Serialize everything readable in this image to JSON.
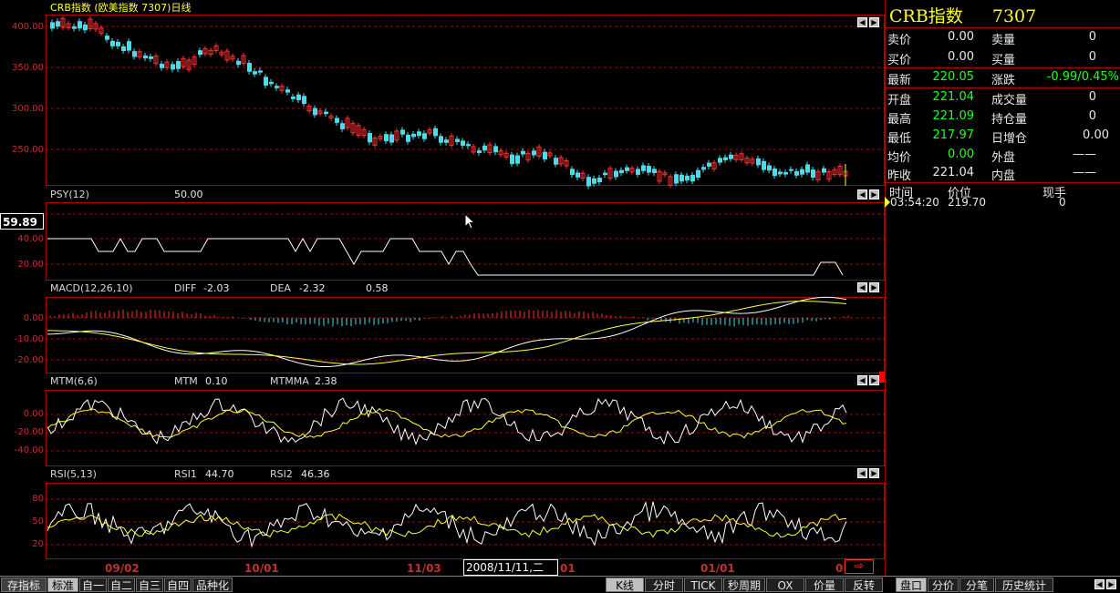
{
  "header": {
    "title": "CRB指数 (欧美指数 7307)日线"
  },
  "panes": {
    "price": {
      "yticks": [
        "400.00",
        "350.00",
        "300.00",
        "250.00"
      ]
    },
    "psy": {
      "name": "PSY(12)",
      "value": "50.00",
      "yticks": [
        "40.00",
        "20.00"
      ],
      "cursor_value": "59.89"
    },
    "macd": {
      "name": "MACD(12,26,10)",
      "diff_label": "DIFF",
      "diff": "-2.03",
      "dea_label": "DEA",
      "dea": "-2.32",
      "macd": "0.58",
      "yticks": [
        "0.00",
        "-10.00",
        "-20.00"
      ]
    },
    "mtm": {
      "name": "MTM(6,6)",
      "mtm_label": "MTM",
      "mtm": "0.10",
      "mtmma_label": "MTMMA",
      "mtmma": "2.38",
      "yticks": [
        "0.00",
        "-20.00",
        "-40.00"
      ]
    },
    "rsi": {
      "name": "RSI(5,13)",
      "rsi1_label": "RSI1",
      "rsi1": "44.70",
      "rsi2_label": "RSI2",
      "rsi2": "46.36",
      "yticks": [
        "80",
        "50",
        "20"
      ]
    }
  },
  "xaxis": {
    "labels": [
      "09/02",
      "10/01",
      "11/03",
      "01",
      "01/01",
      "0"
    ],
    "cursor_date": "2008/11/11,二"
  },
  "quote": {
    "name": "CRB指数",
    "code": "7307",
    "rows": [
      {
        "l1": "卖价",
        "v1": "0.00",
        "l2": "卖量",
        "v2": "0"
      },
      {
        "l1": "买价",
        "v1": "0.00",
        "l2": "买量",
        "v2": "0"
      },
      {
        "l1": "最新",
        "v1": "220.05",
        "l2": "涨跌",
        "v2": "-0.99/0.45%"
      },
      {
        "l1": "开盘",
        "v1": "221.04",
        "l2": "成交量",
        "v2": "0"
      },
      {
        "l1": "最高",
        "v1": "221.09",
        "l2": "持仓量",
        "v2": "0"
      },
      {
        "l1": "最低",
        "v1": "217.97",
        "l2": "日增仓",
        "v2": "0.00"
      },
      {
        "l1": "均价",
        "v1": "0.00",
        "l2": "外盘",
        "v2": "——"
      },
      {
        "l1": "昨收",
        "v1": "221.04",
        "l2": "内盘",
        "v2": "——"
      }
    ],
    "ticks_header": {
      "time": "时间",
      "price": "价位",
      "vol": "现手"
    },
    "ticks": [
      {
        "time": "03:54:20",
        "price": "219.70",
        "vol": "0"
      }
    ]
  },
  "tabs": {
    "left": [
      "存指标",
      "标准",
      "自一",
      "自二",
      "自三",
      "自四",
      "品种化"
    ],
    "right": [
      "K线",
      "分时",
      "TICK",
      "秒周期",
      "OX",
      "价量",
      "反转"
    ],
    "side": [
      "盘口",
      "分价",
      "分笔",
      "历史统计"
    ]
  },
  "colors": {
    "up": "#ff3030",
    "down": "#40e0f0",
    "line1": "#ffffff",
    "line2": "#ffff40",
    "grid": "#b00000"
  }
}
